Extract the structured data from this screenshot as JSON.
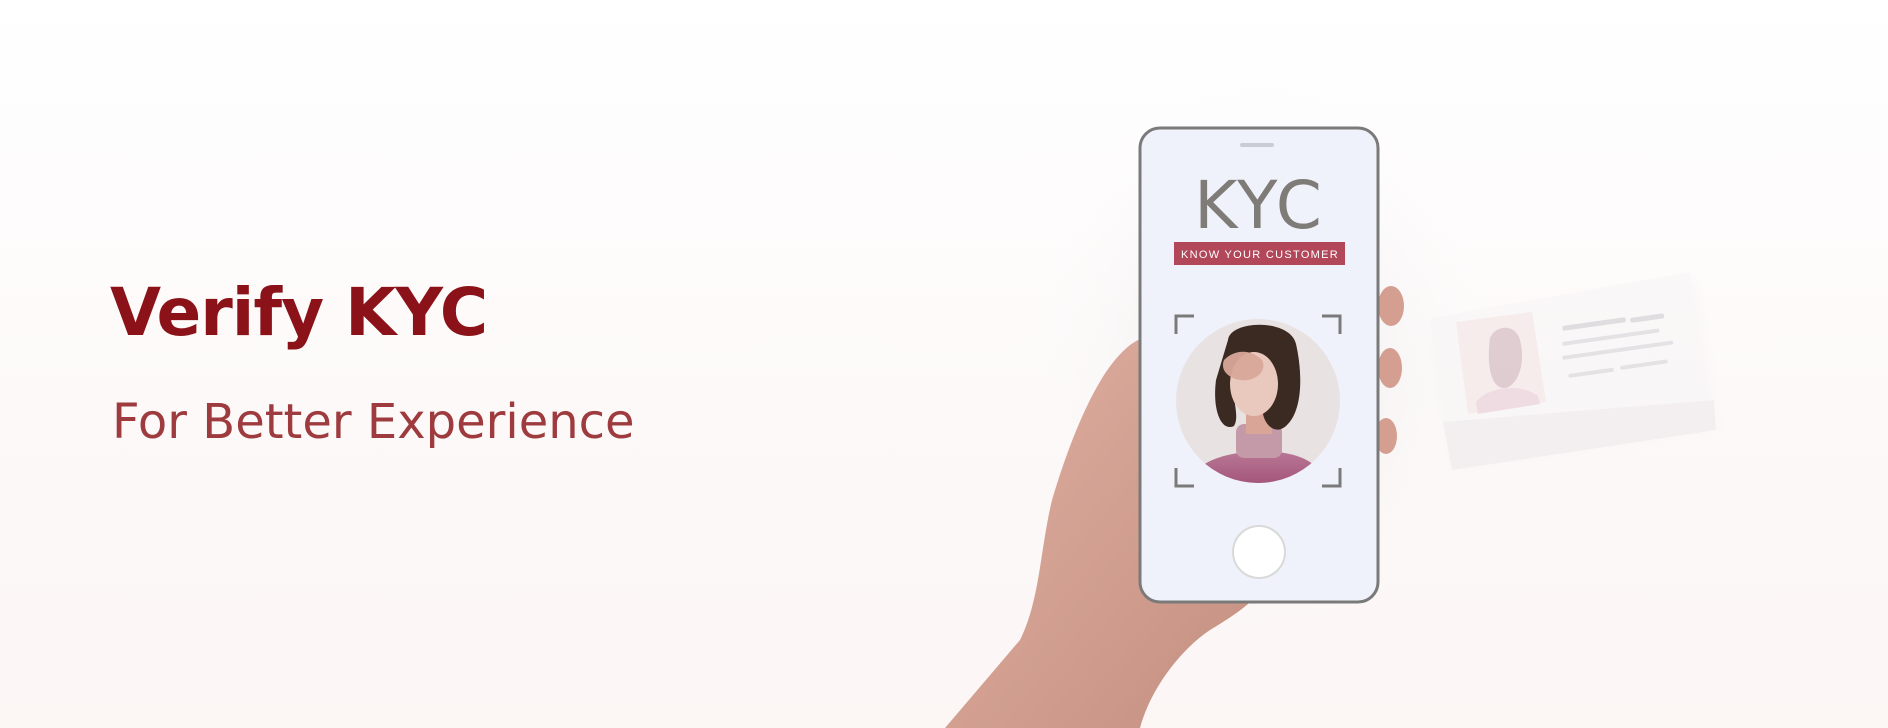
{
  "banner": {
    "headline": "Verify KYC",
    "subheadline": "For Better Experience"
  },
  "phone_screen": {
    "logo_text": "KYC",
    "tagline": "KNOW YOUR CUSTOMER"
  },
  "colors": {
    "headline": "#8b1218",
    "subheadline": "#9e3b3e",
    "tagline_bg": "#b2475a",
    "logo_text": "#7f7c78",
    "phone_frame": "#7a7a7a",
    "phone_screen": "#eff2fb",
    "skin": "#d9a596",
    "hair": "#3a2a22",
    "shirt": "#a85d7e"
  },
  "icons": [
    "hand-illustration",
    "phone-illustration",
    "face-avatar-icon",
    "id-card-illustration"
  ]
}
